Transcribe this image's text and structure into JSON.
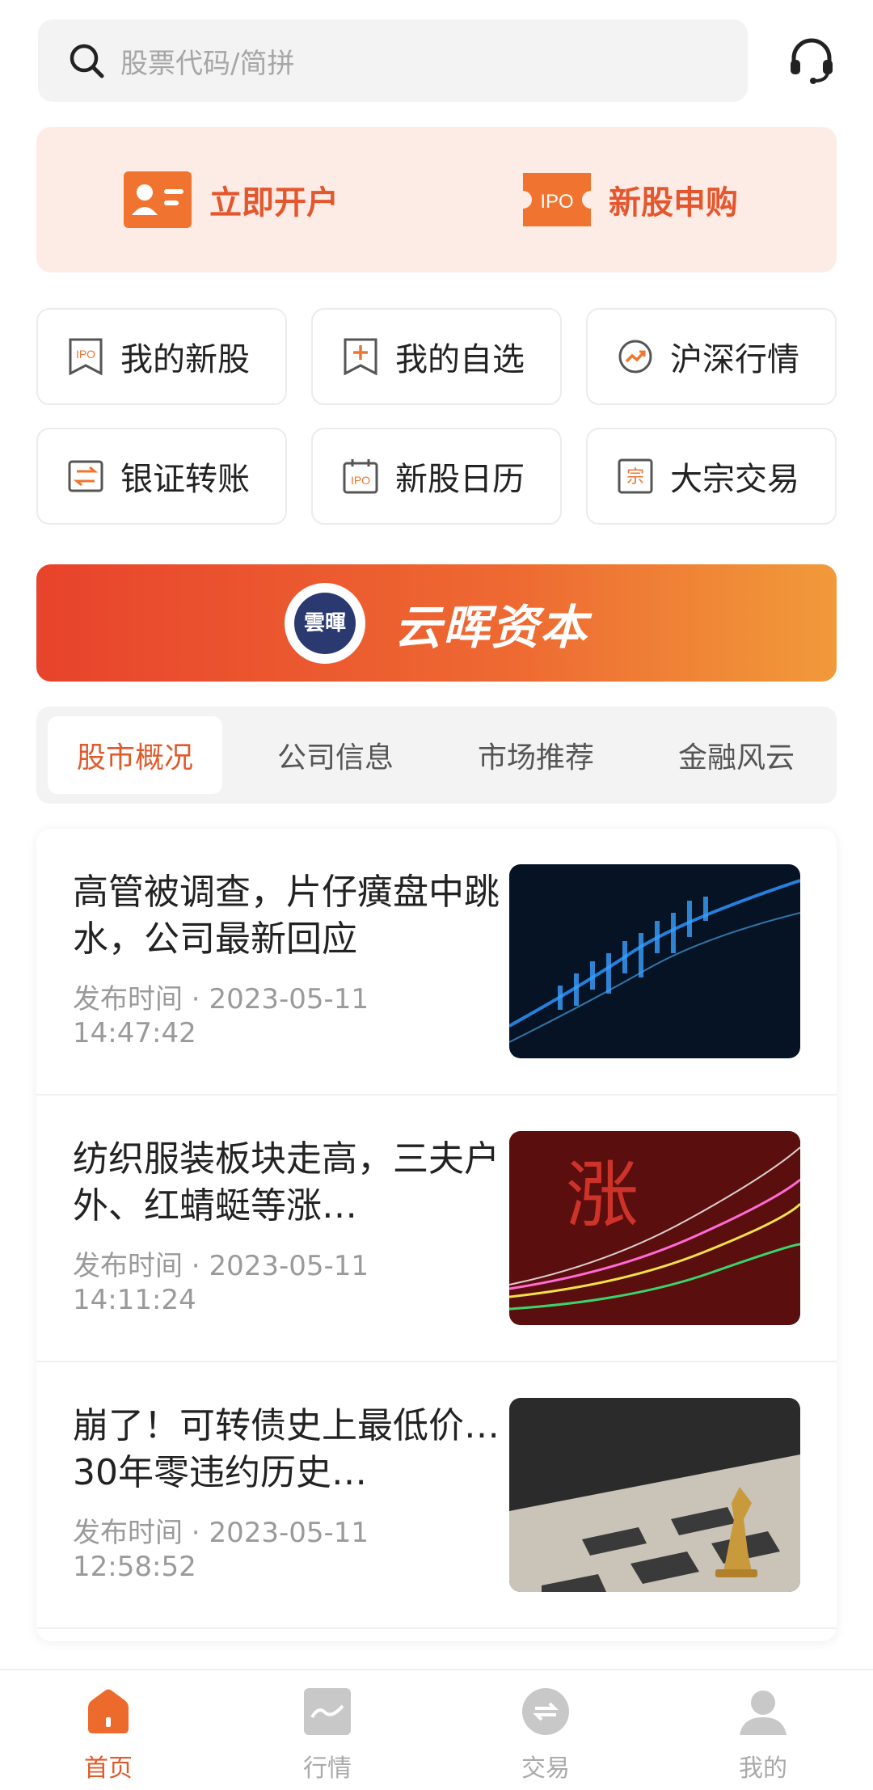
{
  "search": {
    "placeholder": "股票代码/简拼"
  },
  "promo": {
    "open_account": "立即开户",
    "ipo_subscribe": "新股申购",
    "ipo_badge": "IPO"
  },
  "grid": [
    {
      "label": "我的新股",
      "icon": "ipo-icon",
      "icon_text": "IPO"
    },
    {
      "label": "我的自选",
      "icon": "bookmark-plus-icon"
    },
    {
      "label": "沪深行情",
      "icon": "trend-icon"
    },
    {
      "label": "银证转账",
      "icon": "transfer-icon"
    },
    {
      "label": "新股日历",
      "icon": "calendar-ipo-icon",
      "icon_text": "IPO"
    },
    {
      "label": "大宗交易",
      "icon": "block-trade-icon",
      "icon_text": "宗"
    }
  ],
  "banner": {
    "brand": "云晖资本",
    "logo_text": "雲暉"
  },
  "tabs": [
    "股市概况",
    "公司信息",
    "市场推荐",
    "金融风云"
  ],
  "news": [
    {
      "title": "高管被调查，片仔癀盘中跳水，公司最新回应",
      "meta_label": "发布时间",
      "date": "2023-05-11",
      "time": "14:47:42"
    },
    {
      "title": "纺织服装板块走高，三夫户外、红蜻蜓等涨…",
      "meta_label": "发布时间",
      "date": "2023-05-11",
      "time": "14:11:24"
    },
    {
      "title": "崩了！可转债史上最低价…30年零违约历史…",
      "meta_label": "发布时间",
      "date": "2023-05-11",
      "time": "12:58:52"
    }
  ],
  "nav": [
    {
      "label": "首页",
      "icon": "home-icon",
      "active": true
    },
    {
      "label": "行情",
      "icon": "market-icon",
      "active": false
    },
    {
      "label": "交易",
      "icon": "trade-icon",
      "active": false
    },
    {
      "label": "我的",
      "icon": "profile-icon",
      "active": false
    }
  ],
  "colors": {
    "accent": "#e05a2b",
    "promo_bg": "#fdece6",
    "banner_start": "#e8432c",
    "banner_end": "#f19a3a"
  }
}
